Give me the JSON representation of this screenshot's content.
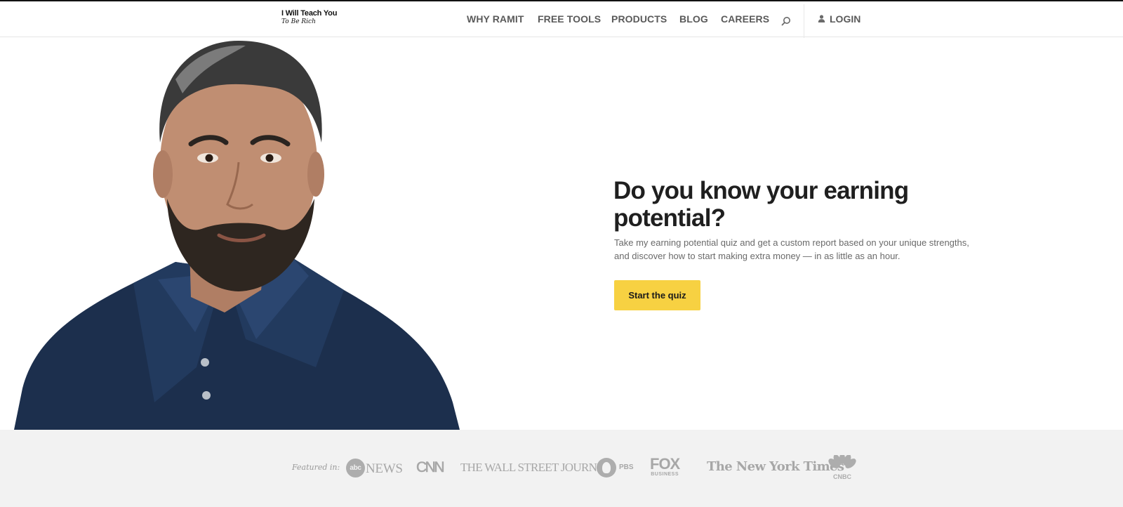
{
  "header": {
    "logo_line1": "I Will Teach You",
    "logo_line2": "To Be Rich",
    "nav": [
      {
        "label": "WHY RAMIT"
      },
      {
        "label": "FREE TOOLS"
      },
      {
        "label": "PRODUCTS"
      },
      {
        "label": "BLOG"
      },
      {
        "label": "CAREERS"
      }
    ],
    "search_icon": "search-icon",
    "user_icon": "user-icon",
    "login_label": "LOGIN"
  },
  "hero": {
    "headline": "Do you know your earning potential?",
    "subtext": "Take my earning potential quiz and get a custom report based on your unique strengths, and discover how to start making extra money — in as little as an hour.",
    "cta_label": "Start the quiz"
  },
  "featured": {
    "label": "Featured in:",
    "logos": {
      "abc": "abc",
      "abc_news": "NEWS",
      "cnn": "CNN",
      "wsj": "THE WALL STREET JOURNAL.",
      "pbs": "PBS",
      "fox_main": "FOX",
      "fox_sub": "BUSINESS",
      "nyt": "The New York Times",
      "cnbc": "CNBC"
    }
  },
  "colors": {
    "cta": "#f7d142",
    "nav_text": "#5a5a5a",
    "headline": "#1f1f1f",
    "band": "#f2f2f2"
  }
}
